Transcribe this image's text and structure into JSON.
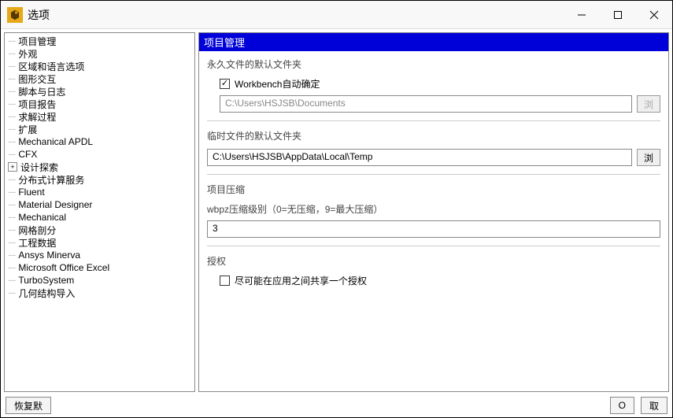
{
  "window": {
    "title": "选项"
  },
  "tree": {
    "items": [
      {
        "label": "项目管理",
        "exp": "dots"
      },
      {
        "label": "外观",
        "exp": "dots"
      },
      {
        "label": "区域和语言选项",
        "exp": "dots"
      },
      {
        "label": "图形交互",
        "exp": "dots"
      },
      {
        "label": "脚本与日志",
        "exp": "dots"
      },
      {
        "label": "项目报告",
        "exp": "dots"
      },
      {
        "label": "求解过程",
        "exp": "dots"
      },
      {
        "label": "扩展",
        "exp": "dots"
      },
      {
        "label": "Mechanical APDL",
        "exp": "dots"
      },
      {
        "label": "CFX",
        "exp": "dots"
      },
      {
        "label": "设计探索",
        "exp": "plus"
      },
      {
        "label": "分布式计算服务",
        "exp": "dots"
      },
      {
        "label": "Fluent",
        "exp": "dots"
      },
      {
        "label": "Material Designer",
        "exp": "dots"
      },
      {
        "label": "Mechanical",
        "exp": "dots"
      },
      {
        "label": "网格剖分",
        "exp": "dots"
      },
      {
        "label": "工程数据",
        "exp": "dots"
      },
      {
        "label": "Ansys Minerva",
        "exp": "dots"
      },
      {
        "label": "Microsoft Office Excel",
        "exp": "dots"
      },
      {
        "label": "TurboSystem",
        "exp": "dots"
      },
      {
        "label": "几何结构导入",
        "exp": "dots"
      }
    ]
  },
  "main": {
    "header": "项目管理",
    "perm_folder": {
      "title": "永久文件的默认文件夹",
      "checkbox_label": "Workbench自动确定",
      "checked": true,
      "path": "C:\\Users\\HSJSB\\Documents",
      "browse": "浏"
    },
    "temp_folder": {
      "title": "临时文件的默认文件夹",
      "path": "C:\\Users\\HSJSB\\AppData\\Local\\Temp",
      "browse": "浏"
    },
    "compression": {
      "title": "项目压缩",
      "sub_label": "wbpz压缩级别（0=无压缩，9=最大压缩）",
      "value": "3"
    },
    "license": {
      "title": "授权",
      "checkbox_label": "尽可能在应用之间共享一个授权",
      "checked": false
    }
  },
  "footer": {
    "restore": "恢复默",
    "ok": "O",
    "cancel": "取"
  }
}
